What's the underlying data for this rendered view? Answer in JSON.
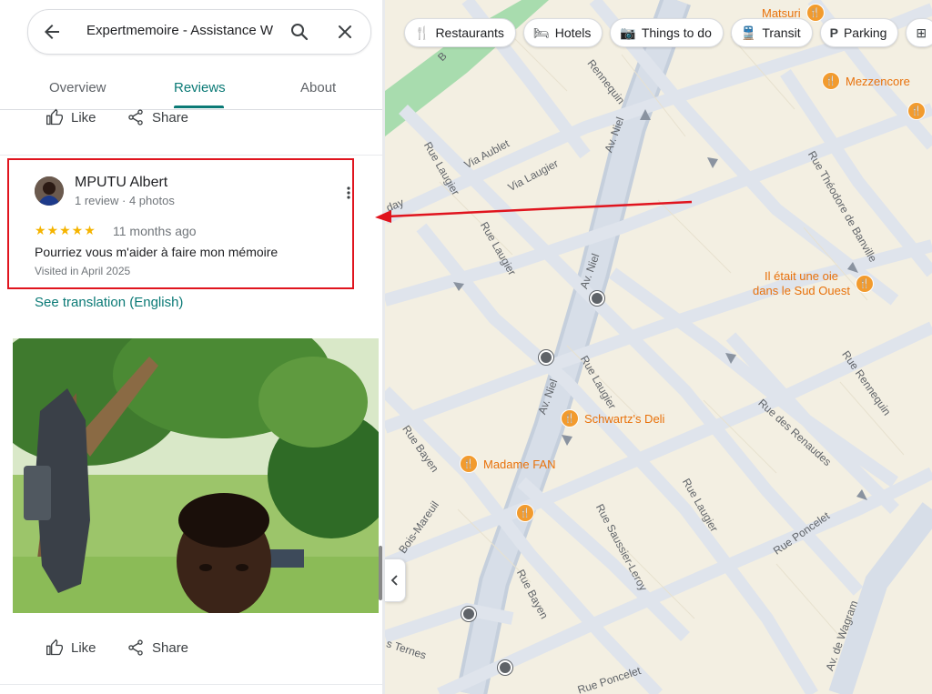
{
  "search": {
    "value": "Expertmemoire - Assistance W"
  },
  "tabs": [
    {
      "label": "Overview"
    },
    {
      "label": "Reviews"
    },
    {
      "label": "About"
    }
  ],
  "actions": {
    "like": "Like",
    "share": "Share"
  },
  "review": {
    "name": "MPUTU Albert",
    "meta": "1 review · 4 photos",
    "stars": "★★★★★",
    "rating": 5,
    "date": "11 months ago",
    "text": "Pourriez vous m'aider à faire mon mémoire",
    "visited": "Visited in April 2025",
    "translation": "See translation (English)"
  },
  "chips": [
    {
      "label": "Restaurants",
      "icon": "utensils-icon"
    },
    {
      "label": "Hotels",
      "icon": "bed-icon"
    },
    {
      "label": "Things to do",
      "icon": "camera-icon"
    },
    {
      "label": "Transit",
      "icon": "bus-icon"
    },
    {
      "label": "Parking",
      "icon": "parking-icon"
    }
  ],
  "map": {
    "pois": {
      "matsuri": "Matsuri",
      "mezzencore": "Mezzencore",
      "oie_line1": "Il était une oie",
      "oie_line2": "dans le Sud Ouest",
      "schwartz": "Schwartz's Deli",
      "madame_fan": "Madame FAN"
    },
    "streets": {
      "rennequin_top": "Rennequin",
      "via_aublet": "Via Aublet",
      "rue_laugier_1": "Rue Laugier",
      "via_laugier": "Via Laugier",
      "av_niel_1": "Av. Niel",
      "rue_laugier_2": "Rue Laugier",
      "rue_theodore": "Rue Théodore de Banville",
      "av_niel_2": "Av. Niel",
      "rue_laugier_3": "Rue Laugier",
      "rue_rennequin": "Rue Rennequin",
      "av_niel_3": "Av. Niel",
      "rue_bayen_1": "Rue Bayen",
      "rue_des_renaudes": "Rue des Renaudes",
      "rue_laugier_4": "Rue Laugier",
      "rue_poncelet": "Rue Poncelet",
      "rue_saussier": "Rue Saussier-Leroy",
      "bois_mareuil": "Bois-Mareuil",
      "rue_bayen_2": "Rue Bayen",
      "av_wagram": "Av. de Wagram",
      "ternes": "s Ternes",
      "rue_poncelet_2": "Rue Poncelet",
      "day": "day",
      "b_top": "B"
    }
  },
  "colors": {
    "accent": "#0b7a76",
    "highlight": "#e0141e",
    "poi": "#f29b2e",
    "star": "#f5b400"
  }
}
